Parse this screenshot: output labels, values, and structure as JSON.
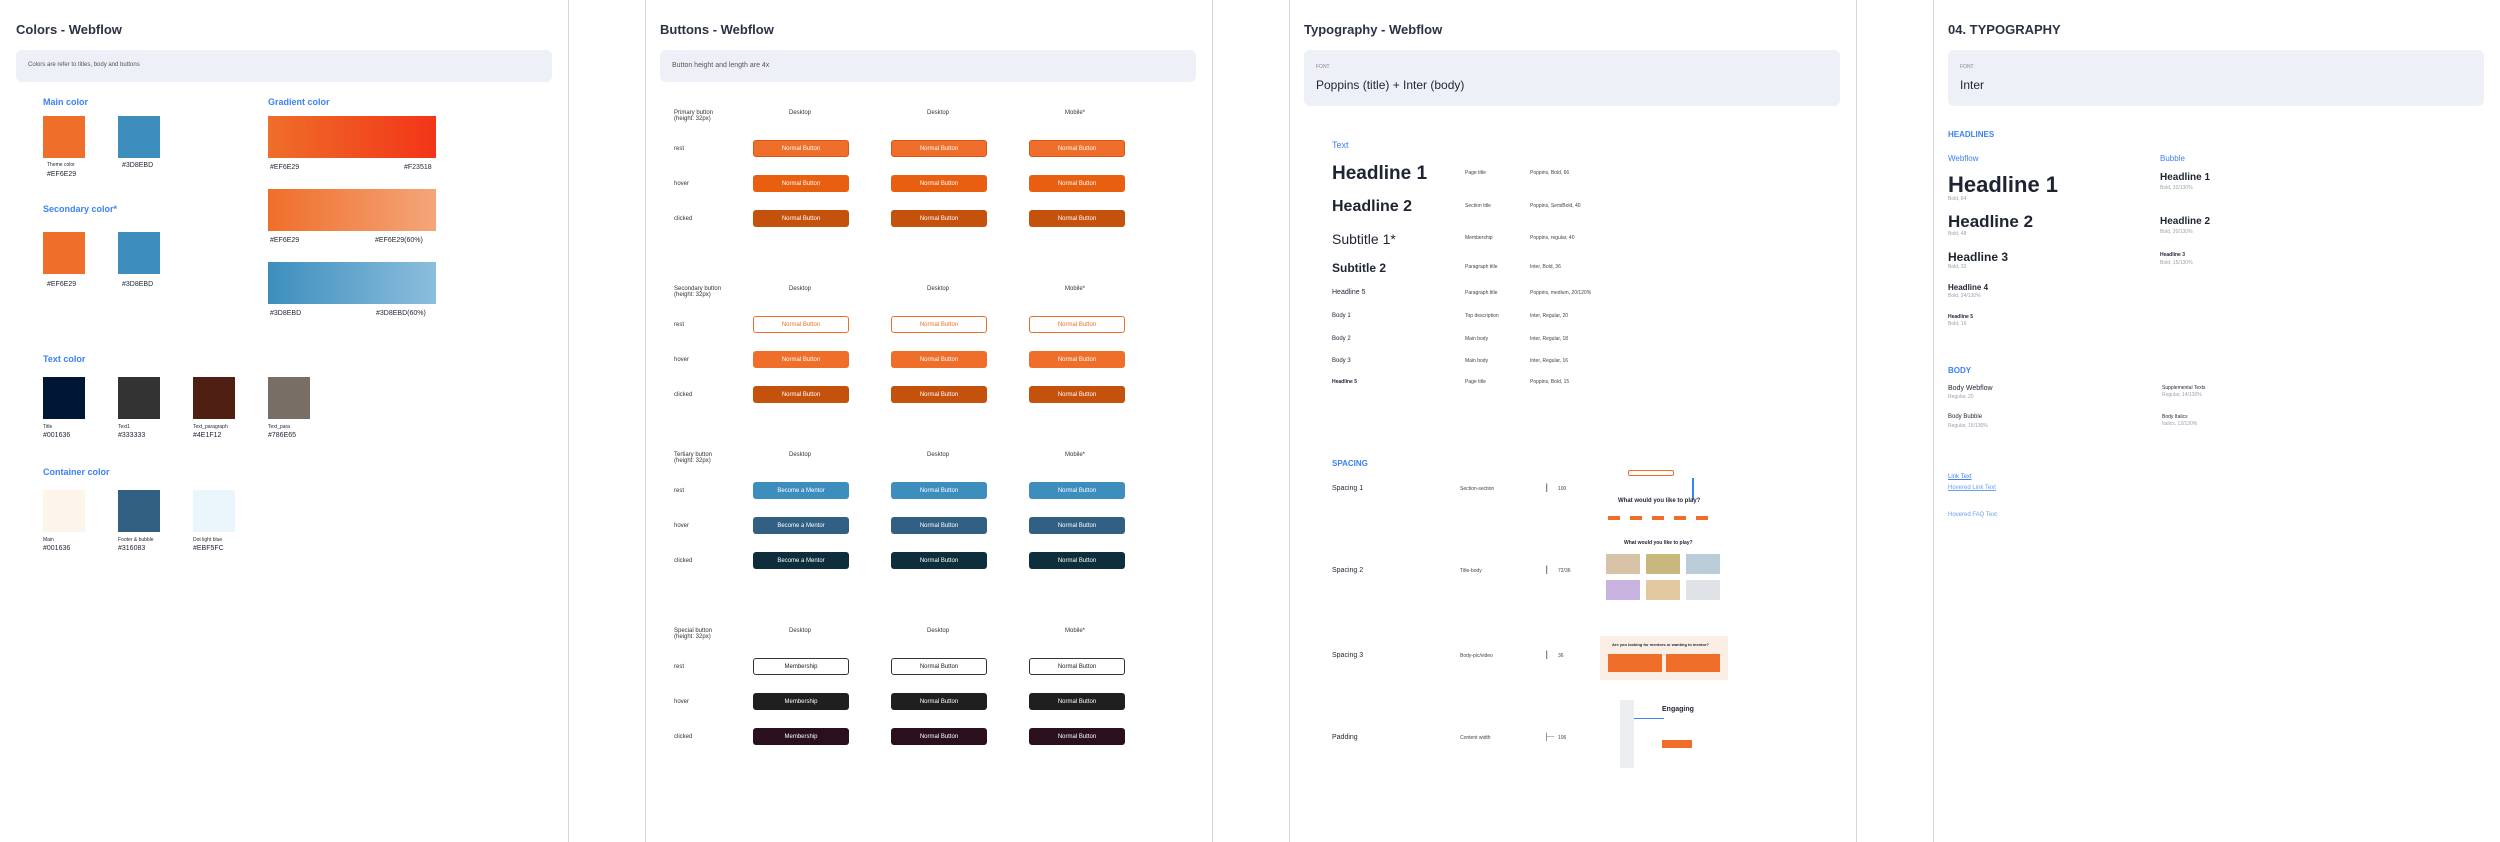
{
  "colors": {
    "title": "Colors - Webflow",
    "note": "Colors are refer to titles, body and buttons",
    "main_title": "Main color",
    "main": [
      {
        "name": "Theme color",
        "hex": "#EF6E29"
      },
      {
        "name": "",
        "hex": "#3D8EBD"
      }
    ],
    "gradient_title": "Gradient color",
    "gradients": [
      {
        "a": "#EF6E29",
        "b": "#F23518"
      },
      {
        "a": "#EF6E29",
        "b": "#EF6E29(60%)"
      },
      {
        "a": "#3D8EBD",
        "b": "#3D8EBD(60%)"
      }
    ],
    "secondary_title": "Secondary color*",
    "secondary": [
      {
        "hex": "#EF6E29"
      },
      {
        "hex": "#3D8EBD"
      }
    ],
    "text_title": "Text color",
    "text": [
      {
        "name": "Title",
        "hex": "#001636"
      },
      {
        "name": "Text1",
        "hex": "#333333"
      },
      {
        "name": "Text_paragraph",
        "hex": "#4E1F12"
      },
      {
        "name": "Text_para",
        "hex": "#786E65"
      }
    ],
    "container_title": "Container color",
    "container": [
      {
        "name": "Main",
        "hex": "#001636"
      },
      {
        "name": "Footer & bubble",
        "hex": "#316083"
      },
      {
        "name": "Dot light blue",
        "hex": "#EBF5FC"
      }
    ],
    "swatch_colors": {
      "orange": "#EF6E29",
      "blue": "#3D8EBD",
      "title": "#001636",
      "text1": "#333333",
      "para": "#4E1F12",
      "para2": "#786E65",
      "cont1": "#FDF5EB",
      "cont2": "#316083",
      "cont3": "#EBF5FC"
    }
  },
  "buttons": {
    "title": "Buttons - Webflow",
    "note": "Button height and length are 4x",
    "col_headers": [
      "Desktop",
      "Desktop",
      "Mobile*"
    ],
    "states": [
      "rest",
      "hover",
      "clicked"
    ],
    "groups": [
      {
        "label": "Primary button",
        "sub": "(height: 32px)",
        "labels": [
          "Normal Button",
          "Normal Button",
          "Normal Button"
        ]
      },
      {
        "label": "Secondary button",
        "sub": "(height: 32px)",
        "labels": [
          "Normal Button",
          "Normal Button",
          "Normal Button"
        ]
      },
      {
        "label": "Tertiary button",
        "sub": "(height: 32px)",
        "labels": [
          "Become a Mentor",
          "Normal Button",
          "Normal Button"
        ]
      },
      {
        "label": "Special button",
        "sub": "(height: 32px)",
        "labels": [
          "Membership",
          "Normal Button",
          "Normal Button"
        ]
      }
    ]
  },
  "typography": {
    "title": "Typography - Webflow",
    "font_label": "FONT",
    "font": "Poppins (title) + Inter (body)",
    "text_title": "Text",
    "rows": [
      {
        "name": "Headline 1",
        "use": "Page title",
        "spec": "Poppins, Bold, 66"
      },
      {
        "name": "Headline 2",
        "use": "Section title",
        "spec": "Poppins, SemiBold, 40"
      },
      {
        "name": "Subtitle 1*",
        "use": "Membership",
        "spec": "Poppins, regular, 40"
      },
      {
        "name": "Subtitle 2",
        "use": "Paragraph title",
        "spec": "Inter, Bold, 36"
      },
      {
        "name": "Headline 5",
        "use": "Paragraph title",
        "spec": "Poppins, medium, 20/120%"
      },
      {
        "name": "Body 1",
        "use": "Top description",
        "spec": "Inter, Regular, 20"
      },
      {
        "name": "Body 2",
        "use": "Main body",
        "spec": "Inter, Regular, 18"
      },
      {
        "name": "Body 3",
        "use": "Main body",
        "spec": "Inter, Regular, 16"
      },
      {
        "name": "Headline 5",
        "use": "Page title",
        "spec": "Poppins, Bold, 15"
      }
    ],
    "spacing_title": "SPACING",
    "spacing": [
      {
        "name": "Spacing 1",
        "use": "Section-section",
        "val": "100"
      },
      {
        "name": "Spacing 2",
        "use": "Title-body",
        "val": "72/36"
      },
      {
        "name": "Spacing 3",
        "use": "Body-pic/video",
        "val": "36"
      },
      {
        "name": "Padding",
        "use": "Content width",
        "val": "106"
      }
    ],
    "preview_q1": "What would you like to play?",
    "preview_q2": "What would you like to play?",
    "preview_q3": "Are you looking for mentors or wanting to mentor?",
    "preview_engaging": "Engaging"
  },
  "typo2": {
    "title": "04. TYPOGRAPHY",
    "font_label": "FONT",
    "font": "Inter",
    "headlines_title": "HEADLINES",
    "webflow": "Webflow",
    "bubble": "Bubble",
    "wf": [
      {
        "n": "Headline 1",
        "s": "Bold, 64"
      },
      {
        "n": "Headline 2",
        "s": "Bold, 48"
      },
      {
        "n": "Headline 3",
        "s": "Bold, 32"
      },
      {
        "n": "Headline 4",
        "s": "Bold, 24/130%"
      },
      {
        "n": "Headline 5",
        "s": "Bold, 16"
      }
    ],
    "bb": [
      {
        "n": "Headline 1",
        "s": "Bold, 32/130%"
      },
      {
        "n": "Headline 2",
        "s": "Bold, 20/130%"
      },
      {
        "n": "Headline 3",
        "s": "Bold, 15/130%"
      }
    ],
    "body_title": "BODY",
    "body": [
      {
        "n": "Body Webflow",
        "s": "Regular, 20"
      },
      {
        "n": "Body Bubble",
        "s": "Regular, 15/130%"
      }
    ],
    "body2": [
      {
        "n": "Supplemental Texts",
        "s": "Regular, 14/130%"
      },
      {
        "n": "Body Italics",
        "s": "Italics, 12/130%"
      }
    ],
    "links": [
      "Link Text",
      "Hovered Link Text",
      "Hovered FAQ Text"
    ]
  }
}
